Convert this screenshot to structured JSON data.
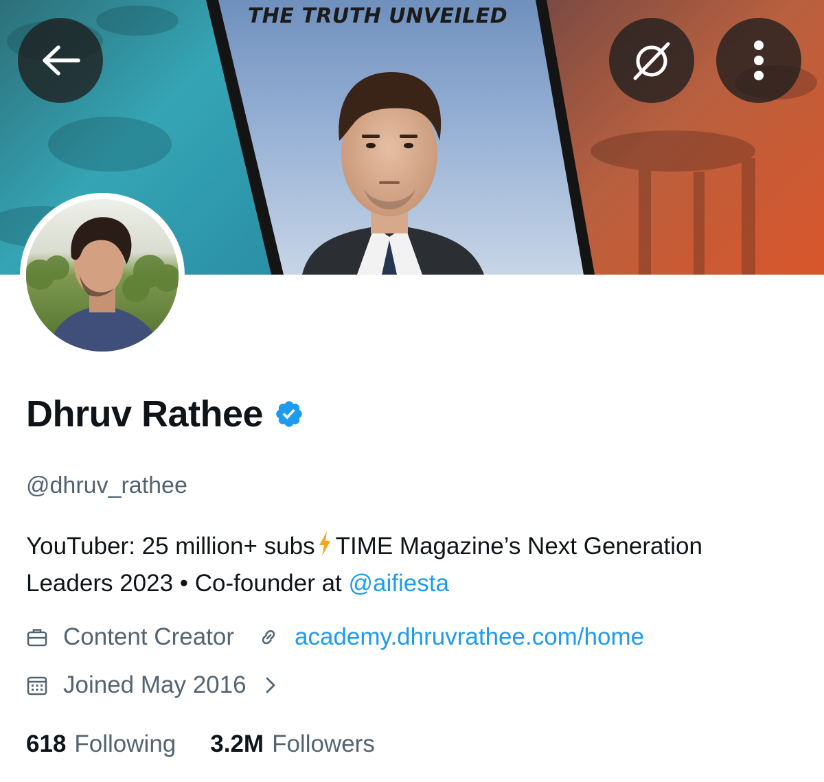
{
  "banner": {
    "caption": "THE TRUTH UNVEILED"
  },
  "header": {
    "back_icon": "arrow-left-icon",
    "grok_icon": "grok-icon",
    "more_icon": "more-vertical-icon"
  },
  "profile": {
    "name": "Dhruv Rathee",
    "verified": true,
    "handle": "@dhruv_rathee",
    "bio_line1_before": "YouTuber: 25 million+ subs",
    "bio_line1_after": "TIME Magazine’s Next Generation",
    "bio_line2_before": "Leaders 2023 • Co-founder at ",
    "bio_mention": "@aifiesta",
    "category": "Content Creator",
    "website": "academy.dhruvrathee.com/home",
    "joined": "Joined May 2016"
  },
  "stats": {
    "following_count": "618",
    "following_label": "Following",
    "followers_count": "3.2M",
    "followers_label": "Followers"
  },
  "colors": {
    "link": "#1d9bf0",
    "secondary_text": "#536471",
    "verified": "#1d9bf0"
  }
}
